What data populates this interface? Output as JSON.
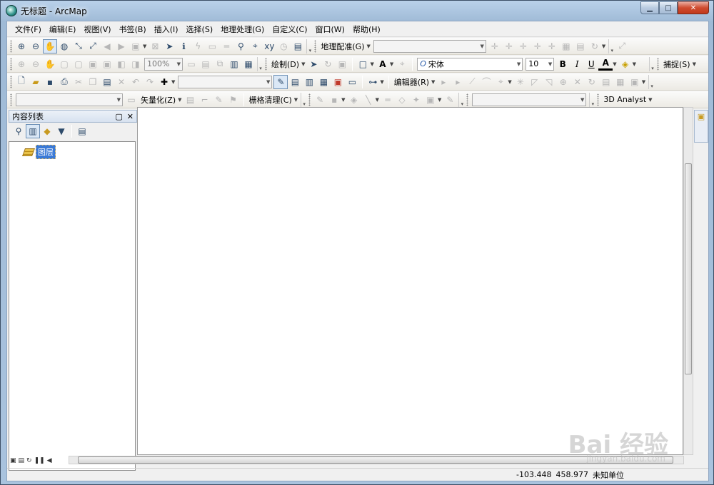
{
  "window": {
    "title": "无标题 - ArcMap",
    "min_icon": "minimize-icon",
    "max_icon": "maximize-icon",
    "close_icon": "close-icon"
  },
  "menu": [
    "文件(F)",
    "编辑(E)",
    "视图(V)",
    "书签(B)",
    "插入(I)",
    "选择(S)",
    "地理处理(G)",
    "自定义(C)",
    "窗口(W)",
    "帮助(H)"
  ],
  "toolbars": {
    "georeferencing_label": "地理配准(G)",
    "zoom_value": "100%",
    "drawing_label": "绘制(D)",
    "font_name": "宋体",
    "font_size": "10",
    "bold": "B",
    "italic": "I",
    "underline": "U",
    "font_color_glyph": "A",
    "snapping_label": "捕捉(S)",
    "editor_label": "编辑器(R)",
    "vectorization_label": "矢量化(Z)",
    "raster_cleanup_label": "栅格清理(C)",
    "analyst_label": "3D Analyst"
  },
  "toc": {
    "title": "内容列表",
    "layer_label": "图层"
  },
  "status": {
    "x": "-103.448",
    "y": "458.977",
    "units": "未知单位"
  },
  "watermark": {
    "main": "Bai 经验",
    "sub": "jingyan.baidu.com"
  },
  "colors": {
    "title_gradient": "#b9d1ea",
    "close_button": "#cf4b2f",
    "selection": "#3a79d6",
    "background": "#f0f0f0"
  }
}
